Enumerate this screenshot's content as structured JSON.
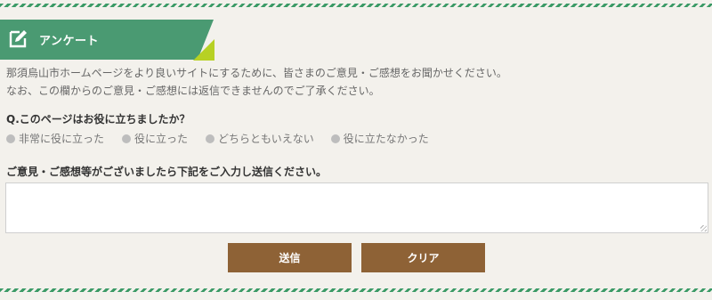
{
  "survey": {
    "title": "アンケート",
    "intro_line1": "那須烏山市ホームページをより良いサイトにするために、皆さまのご意見・ご感想をお聞かせください。",
    "intro_line2": "なお、この欄からのご意見・ご感想には返信できませんのでご了承ください。",
    "question": "Q.このページはお役に立ちましたか？",
    "options": [
      "非常に役に立った",
      "役に立った",
      "どちらともいえない",
      "役に立たなかった"
    ],
    "comment_label": "ご意見・ご感想等がございましたら下記をご入力し送信ください。",
    "comment_value": "",
    "submit_label": "送信",
    "clear_label": "クリア"
  },
  "colors": {
    "header_green": "#4a9a72",
    "accent_lime": "#b7d124",
    "button_brown": "#8e6236",
    "stripe_green": "#3b9a66"
  },
  "icons": {
    "header": "pencil-edit-icon"
  }
}
